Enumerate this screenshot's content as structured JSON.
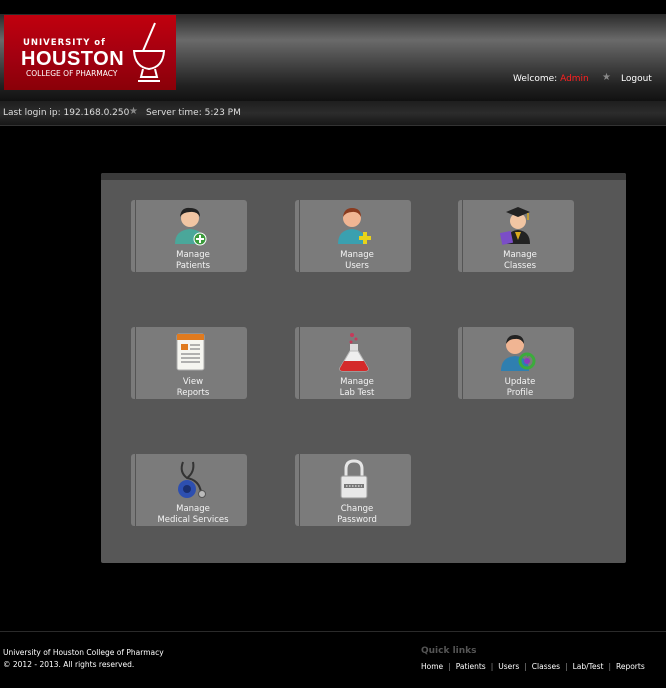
{
  "header": {
    "logo": {
      "line1": "UNIVERSITY of",
      "line2": "HOUSTON",
      "line3": "COLLEGE OF PHARMACY"
    },
    "welcome_label": "Welcome:",
    "user_name": "Admin",
    "logout_label": "Logout",
    "accent_color": "#ff2020"
  },
  "infobar": {
    "last_login": "Last login ip: 192.168.0.250",
    "server_time": "Server time: 5:23 PM"
  },
  "tiles": [
    {
      "line1": "Manage",
      "line2": "Patients",
      "icon": "patient-icon"
    },
    {
      "line1": "Manage",
      "line2": "Users",
      "icon": "user-add-icon"
    },
    {
      "line1": "Manage",
      "line2": "Classes",
      "icon": "graduate-icon"
    },
    {
      "line1": "View",
      "line2": "Reports",
      "icon": "report-icon"
    },
    {
      "line1": "Manage",
      "line2": "Lab Test",
      "icon": "flask-icon"
    },
    {
      "line1": "Update",
      "line2": "Profile",
      "icon": "profile-update-icon"
    },
    {
      "line1": "Manage",
      "line2": "Medical Services",
      "icon": "stethoscope-icon"
    },
    {
      "line1": "Change",
      "line2": "Password",
      "icon": "padlock-icon"
    }
  ],
  "footer": {
    "org": "University of Houston College of Pharmacy",
    "copyright": "© 2012 - 2013. All rights reserved.",
    "quick_links_title": "Quick links",
    "links": [
      "Home",
      "Patients",
      "Users",
      "Classes",
      "Lab/Test",
      "Reports"
    ]
  }
}
